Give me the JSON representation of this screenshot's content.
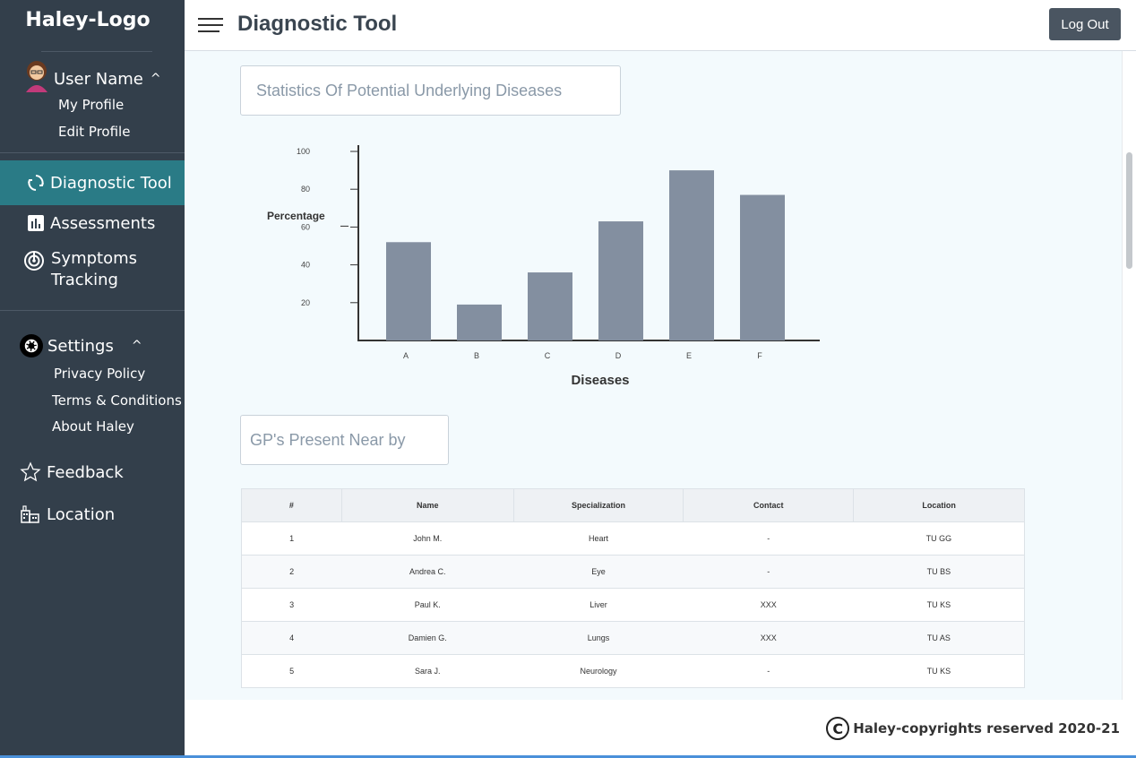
{
  "sidebar": {
    "logo": "Haley-Logo",
    "user": {
      "name": "User Name",
      "caret": "^"
    },
    "profile_items": [
      "My Profile",
      "Edit Profile"
    ],
    "nav": {
      "diagnostic": "Diagnostic Tool",
      "assessments": "Assessments",
      "symptoms": [
        "Symptoms",
        "Tracking"
      ],
      "settings": "Settings",
      "settings_caret": "^",
      "settings_items": [
        "Privacy Policy",
        "Terms & Conditions",
        "About Haley"
      ],
      "feedback": "Feedback",
      "location": "Location"
    },
    "colors": {
      "background": "#333f4b",
      "active": "#2a7b86"
    }
  },
  "header": {
    "title": "Diagnostic Tool",
    "logout_label": "Log Out"
  },
  "main": {
    "stats_title": "Statistics Of Potential Underlying Diseases",
    "gp_title": "GP's Present Near by"
  },
  "chart_data": {
    "type": "bar",
    "categories": [
      "A",
      "B",
      "C",
      "D",
      "E",
      "F"
    ],
    "values": [
      52,
      19,
      36,
      63,
      90,
      77
    ],
    "title": "",
    "xlabel": "Diseases",
    "ylabel": "Percentage",
    "yticks": [
      20,
      40,
      60,
      80,
      100
    ],
    "ylim": [
      0,
      110
    ],
    "bar_color": "#838fa0",
    "grid": false
  },
  "gp_table": {
    "headers": [
      "#",
      "Name",
      "Specialization",
      "Contact",
      "Location"
    ],
    "rows": [
      [
        "1",
        "John M.",
        "Heart",
        "-",
        "TU GG"
      ],
      [
        "2",
        "Andrea C.",
        "Eye",
        "-",
        "TU BS"
      ],
      [
        "3",
        "Paul K.",
        "Liver",
        "XXX",
        "TU KS"
      ],
      [
        "4",
        "Damien G.",
        "Lungs",
        "XXX",
        "TU AS"
      ],
      [
        "5",
        "Sara J.",
        "Neurology",
        "-",
        "TU KS"
      ]
    ]
  },
  "footer": {
    "copyright_symbol": "C",
    "text": "Haley-copyrights reserved 2020-21"
  }
}
